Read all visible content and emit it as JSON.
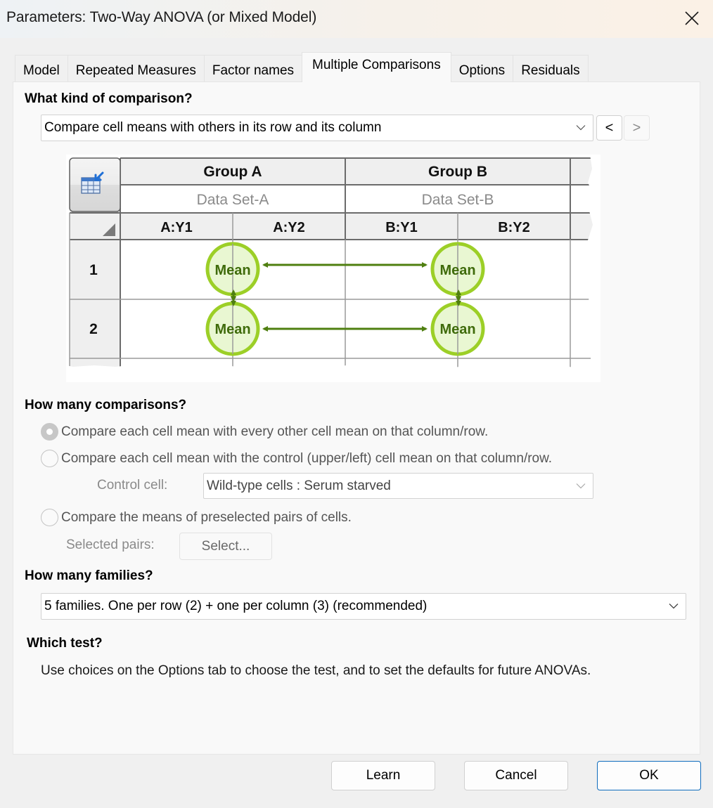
{
  "window": {
    "title": "Parameters: Two-Way ANOVA (or Mixed Model)",
    "close_icon": "close-x-icon"
  },
  "tabs": [
    {
      "label": "Model",
      "active": false
    },
    {
      "label": "Repeated Measures",
      "active": false
    },
    {
      "label": "Factor names",
      "active": false
    },
    {
      "label": "Multiple Comparisons",
      "active": true
    },
    {
      "label": "Options",
      "active": false
    },
    {
      "label": "Residuals",
      "active": false
    }
  ],
  "comparison_kind": {
    "heading": "What kind of comparison?",
    "selected": "Compare cell means with others in its row and its column",
    "prev_label": "<",
    "next_label": ">"
  },
  "diagram": {
    "groups": [
      {
        "title": "Group A",
        "dataset": "Data Set-A",
        "columns": [
          "A:Y1",
          "A:Y2"
        ]
      },
      {
        "title": "Group B",
        "dataset": "Data Set-B",
        "columns": [
          "B:Y1",
          "B:Y2"
        ]
      }
    ],
    "rows": [
      "1",
      "2"
    ],
    "mean_label": "Mean",
    "accent_colors": {
      "circle_stroke": "#9ccf27",
      "circle_fill": "#e9f7d2",
      "arrow": "#4f7f10",
      "mean_text": "#3f6b0b"
    }
  },
  "comparisons_count": {
    "heading": "How many comparisons?",
    "options": [
      {
        "label": "Compare each cell mean with every other cell mean on that column/row.",
        "checked": true
      },
      {
        "label": "Compare each cell mean with the control (upper/left) cell mean on that column/row.",
        "checked": false
      },
      {
        "label": "Compare the means of preselected pairs of cells.",
        "checked": false
      }
    ],
    "control_cell_label": "Control cell:",
    "control_cell_value": "Wild-type cells : Serum starved",
    "selected_pairs_label": "Selected pairs:",
    "select_button": "Select..."
  },
  "families": {
    "heading": "How many families?",
    "selected": "5 families. One per row (2) + one per column (3) (recommended)"
  },
  "which_test": {
    "heading": "Which test?",
    "text": "Use choices on the Options tab to choose the test, and to set the defaults for future ANOVAs."
  },
  "footer": {
    "learn": "Learn",
    "cancel": "Cancel",
    "ok": "OK"
  }
}
